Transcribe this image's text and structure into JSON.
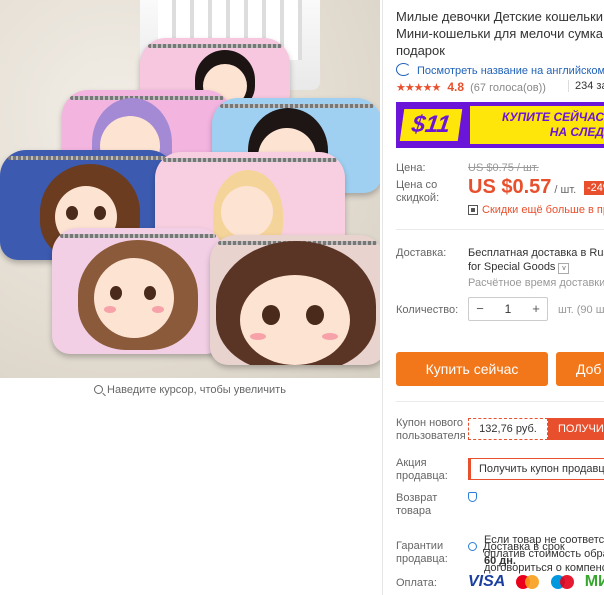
{
  "gallery": {
    "zoom_hint": "Наведите курсор, чтобы увеличить"
  },
  "product": {
    "title_line1": "Милые девочки Детские кошельки",
    "title_line2": "Мини-кошельки для мелочи сумка",
    "title_line3": "подарок",
    "translate_link": "Посмотреть название на английском",
    "stars": "★★★★★",
    "rating": "4.8",
    "votes": "(67 голоса(ов))",
    "orders": "234 за"
  },
  "promo": {
    "amount": "$11",
    "text": "КУПИТЕ СЕЙЧАС\nНА СЛЕД"
  },
  "price": {
    "label": "Цена:",
    "old_price": "US $0.75 / шт.",
    "discount_label": "Цена со\nскидкой:",
    "new_price": "US $0.57",
    "unit": "/ шт.",
    "discount": "-24%",
    "more_discounts": "Скидки ещё больше в пр"
  },
  "shipping": {
    "label": "Доставка:",
    "line1": "Бесплатная доставка в Rus",
    "line2": "for Special Goods",
    "estimate": "Расчётное время доставки"
  },
  "quantity": {
    "label": "Количество:",
    "minus": "−",
    "value": "1",
    "plus": "+",
    "stock": "шт. (90 шт"
  },
  "actions": {
    "buy_now": "Купить сейчас",
    "add_to_cart": "Доб"
  },
  "coupons": {
    "new_user_label": "Купон нового\nпользователя",
    "new_user_value": "132,76 руб.",
    "new_user_button": "ПОЛУЧИТЬ",
    "seller_label": "Акция\nпродавца:",
    "seller_button": "Получить купон продавца"
  },
  "returns": {
    "label": "Возврат\nтовара",
    "text": "Если товар не соответсте\nоплатив стоимость обрат\nдоговориться о компенс"
  },
  "guarantee": {
    "label": "Гарантии\nпродавца:",
    "line1": "Доставка в срок",
    "line2": "60 дн."
  },
  "payment": {
    "label": "Оплата:",
    "visa": "VISA",
    "mir": "МИ"
  }
}
